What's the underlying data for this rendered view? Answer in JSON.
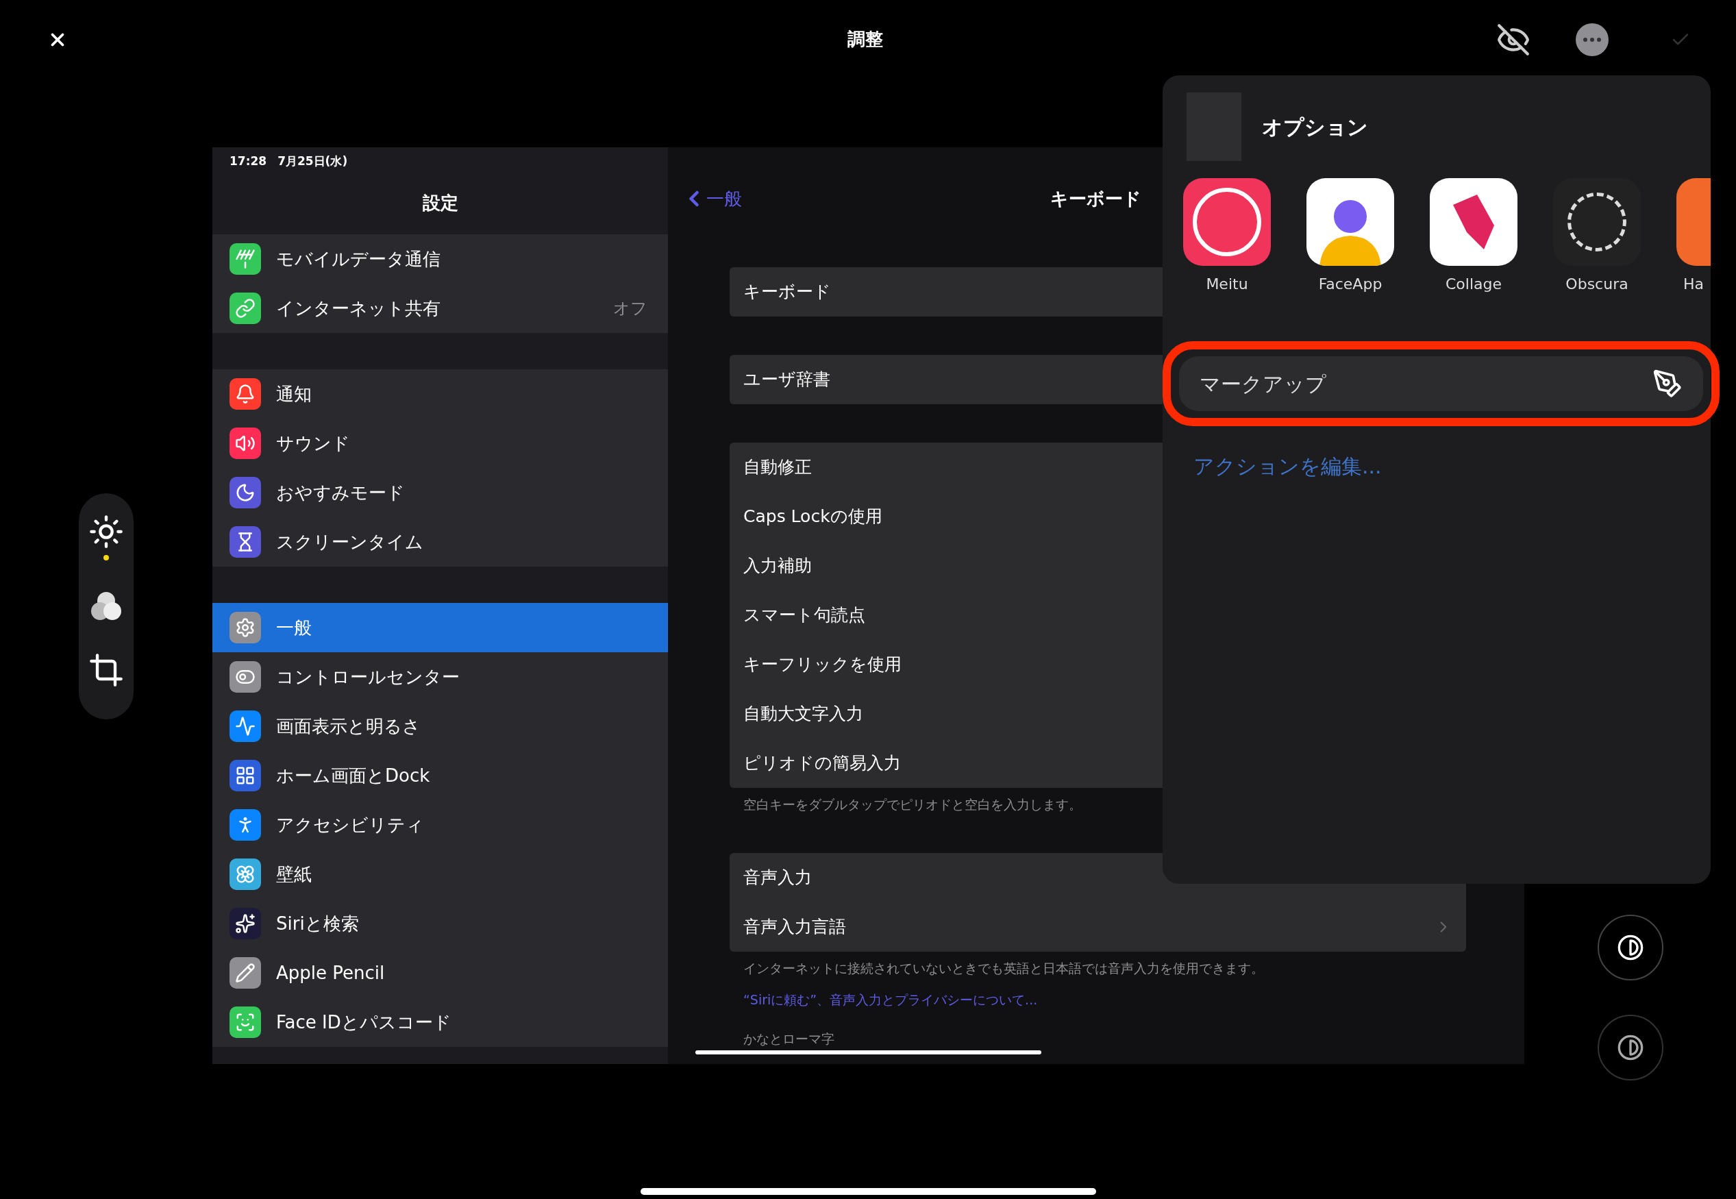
{
  "top_bar": {
    "title": "調整"
  },
  "tools": [
    {
      "kind": "adjust",
      "selected": true
    },
    {
      "kind": "filters",
      "selected": false
    },
    {
      "kind": "crop",
      "selected": false
    }
  ],
  "screenshot": {
    "status_bar": {
      "time": "17:28",
      "date": "7月25日(水)"
    },
    "sidebar": {
      "title": "設定",
      "groups": [
        {
          "items": [
            {
              "label": "モバイルデータ通信",
              "kind": "antenna",
              "color": "#34c759",
              "selected": false
            },
            {
              "label": "インターネット共有",
              "kind": "link",
              "color": "#34c759",
              "value": "オフ",
              "selected": false
            }
          ]
        },
        {
          "items": [
            {
              "label": "通知",
              "kind": "bell",
              "color": "#ff3b30",
              "selected": false
            },
            {
              "label": "サウンド",
              "kind": "speaker",
              "color": "#ff2d55",
              "selected": false
            },
            {
              "label": "おやすみモード",
              "kind": "moon",
              "color": "#5856d6",
              "selected": false
            },
            {
              "label": "スクリーンタイム",
              "kind": "hourglass",
              "color": "#5856d6",
              "selected": false
            }
          ]
        },
        {
          "items": [
            {
              "label": "一般",
              "kind": "gear",
              "color": "#8e8e93",
              "selected": true
            },
            {
              "label": "コントロールセンター",
              "kind": "toggles",
              "color": "#8e8e93",
              "selected": false
            },
            {
              "label": "画面表示と明るさ",
              "kind": "wave",
              "color": "#0a84ff",
              "selected": false
            },
            {
              "label": "ホーム画面とDock",
              "kind": "grid",
              "color": "#2c5fd9",
              "selected": false
            },
            {
              "label": "アクセシビリティ",
              "kind": "accessibility",
              "color": "#0a84ff",
              "selected": false
            },
            {
              "label": "壁紙",
              "kind": "flower",
              "color": "#35aadc",
              "selected": false
            },
            {
              "label": "Siriと検索",
              "kind": "sparkles",
              "color": "#1c1c3a",
              "selected": false
            },
            {
              "label": "Apple Pencil",
              "kind": "pencil",
              "color": "#8e8e93",
              "selected": false
            },
            {
              "label": "Face IDとパスコード",
              "kind": "face",
              "color": "#34c759",
              "selected": false
            }
          ]
        }
      ]
    },
    "detail": {
      "back": "一般",
      "title": "キーボード",
      "groups": [
        {
          "rows": [
            {
              "label": "キーボード",
              "kind": "plain"
            }
          ]
        },
        {
          "rows": [
            {
              "label": "ユーザ辞書",
              "kind": "plain"
            }
          ]
        },
        {
          "rows": [
            {
              "label": "自動修正",
              "kind": "plain"
            },
            {
              "label": "Caps Lockの使用",
              "kind": "plain"
            },
            {
              "label": "入力補助",
              "kind": "plain"
            },
            {
              "label": "スマート句読点",
              "kind": "plain"
            },
            {
              "label": "キーフリックを使用",
              "kind": "plain"
            },
            {
              "label": "自動大文字入力",
              "kind": "plain"
            },
            {
              "label": "ピリオドの簡易入力",
              "kind": "plain"
            }
          ],
          "footer": "空白キーをダブルタップでピリオドと空白を入力します。"
        },
        {
          "rows": [
            {
              "label": "音声入力",
              "kind": "plain"
            },
            {
              "label": "音声入力言語",
              "kind": "disclosure"
            }
          ],
          "footer": "インターネットに接続されていないときでも英語と日本語では音声入力を使用できます。"
        }
      ],
      "footer_link": "“Siriに頼む”、音声入力とプライバシーについて...",
      "section_header": "かなとローマ字"
    }
  },
  "popover": {
    "title": "オプション",
    "apps": [
      {
        "name": "Meitu",
        "kind": "meitu"
      },
      {
        "name": "FaceApp",
        "kind": "faceapp"
      },
      {
        "name": "Collage",
        "kind": "collage"
      },
      {
        "name": "Obscura",
        "kind": "obscura"
      },
      {
        "name": "Ha",
        "kind": "orange"
      }
    ],
    "action": "マークアップ",
    "edit_link": "アクションを編集..."
  }
}
